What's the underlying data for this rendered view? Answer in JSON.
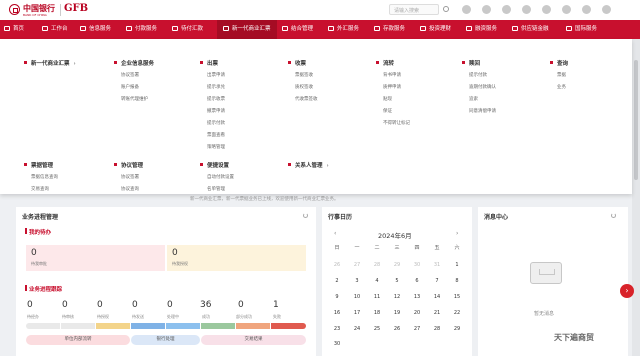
{
  "header": {
    "logo_cn": "中国银行",
    "logo_en": "BANK OF CHINA",
    "logo_gfb": "GFB",
    "search_placeholder": "请输入搜索"
  },
  "nav": {
    "items": [
      "首页",
      "工作台",
      "信息服务",
      "付款服务",
      "待付汇款",
      "新一代商业汇票",
      "结合管理",
      "外汇服务",
      "存款服务",
      "投资理财",
      "融资服务",
      "供应链金融",
      "国际服务"
    ]
  },
  "menu": {
    "col1_head": "新一代商业汇票",
    "g1": {
      "head": "企业信息服务",
      "items": [
        "协议签署",
        "账户报备",
        "转账代理维护"
      ]
    },
    "g2": {
      "head": "出票",
      "items": [
        "出票申请",
        "提示承兑",
        "提示收票",
        "撤票申请",
        "提示付款",
        "票面查看",
        "策略管理"
      ]
    },
    "g3": {
      "head": "收票",
      "items": [
        "票据签收",
        "质权签收",
        "代收票签收"
      ]
    },
    "g4": {
      "head": "流转",
      "items": [
        "背书申请",
        "质押申请",
        "贴现",
        "保证",
        "不得转让标记"
      ]
    },
    "g5": {
      "head": "赎回",
      "items": [
        "提示付款",
        "逾期付款确认",
        "追索",
        "同意清偿申请"
      ]
    },
    "g6": {
      "head": "查询",
      "items": [
        "票据",
        "业务"
      ]
    },
    "g7": {
      "head": "票据管理",
      "items": [
        "票据信息查询",
        "交易查询"
      ]
    },
    "g8": {
      "head": "协议管理",
      "items": [
        "协议签署",
        "协议查询"
      ]
    },
    "g9": {
      "head": "便捷设置",
      "items": [
        "自动付款设置",
        "名单管理"
      ]
    },
    "g10": {
      "head": "关系人管理"
    }
  },
  "background_text": "新一代商业汇票，新一代票据业务已上线，欢迎使用新一代商业汇票业务。",
  "business": {
    "title": "业务进程管理",
    "todo_title": "我的待办",
    "todo": [
      {
        "num": "0",
        "label": "待我审批"
      },
      {
        "num": "0",
        "label": "待我授权"
      }
    ],
    "track_title": "业务进程跟踪",
    "stats": [
      {
        "num": "0",
        "label": "待经办"
      },
      {
        "num": "0",
        "label": "待审核"
      },
      {
        "num": "0",
        "label": "待授权"
      },
      {
        "num": "0",
        "label": "待发送"
      },
      {
        "num": "0",
        "label": "处理中"
      },
      {
        "num": "36",
        "label": "成功"
      },
      {
        "num": "0",
        "label": "部分成功"
      },
      {
        "num": "1",
        "label": "失败"
      }
    ],
    "stages": [
      "单位内部流转",
      "银行处理",
      "交易结果"
    ]
  },
  "calendar": {
    "title": "行事日历",
    "month": "2024年6月",
    "weekdays": [
      "日",
      "一",
      "二",
      "三",
      "四",
      "五",
      "六"
    ],
    "rows": [
      [
        "26",
        "27",
        "28",
        "29",
        "30",
        "31",
        "1"
      ],
      [
        "2",
        "3",
        "4",
        "5",
        "6",
        "7",
        "8"
      ],
      [
        "9",
        "10",
        "11",
        "12",
        "13",
        "14",
        "15"
      ],
      [
        "16",
        "17",
        "18",
        "19",
        "20",
        "21",
        "22"
      ],
      [
        "23",
        "24",
        "25",
        "26",
        "27",
        "28",
        "29"
      ],
      [
        "30",
        "",
        "",
        "",
        "",
        "",
        ""
      ]
    ]
  },
  "messages": {
    "title": "消息中心",
    "empty": "暂无消息"
  },
  "watermark": "天下遍商贸",
  "colors": {
    "brand_red": "#c8102e",
    "todo_red": "#fde8ea",
    "todo_yellow": "#fdf3dc",
    "stage_red": "#fbdcdf",
    "stage_blue": "#dbe7f7",
    "stage_pink": "#f8e0e8"
  }
}
